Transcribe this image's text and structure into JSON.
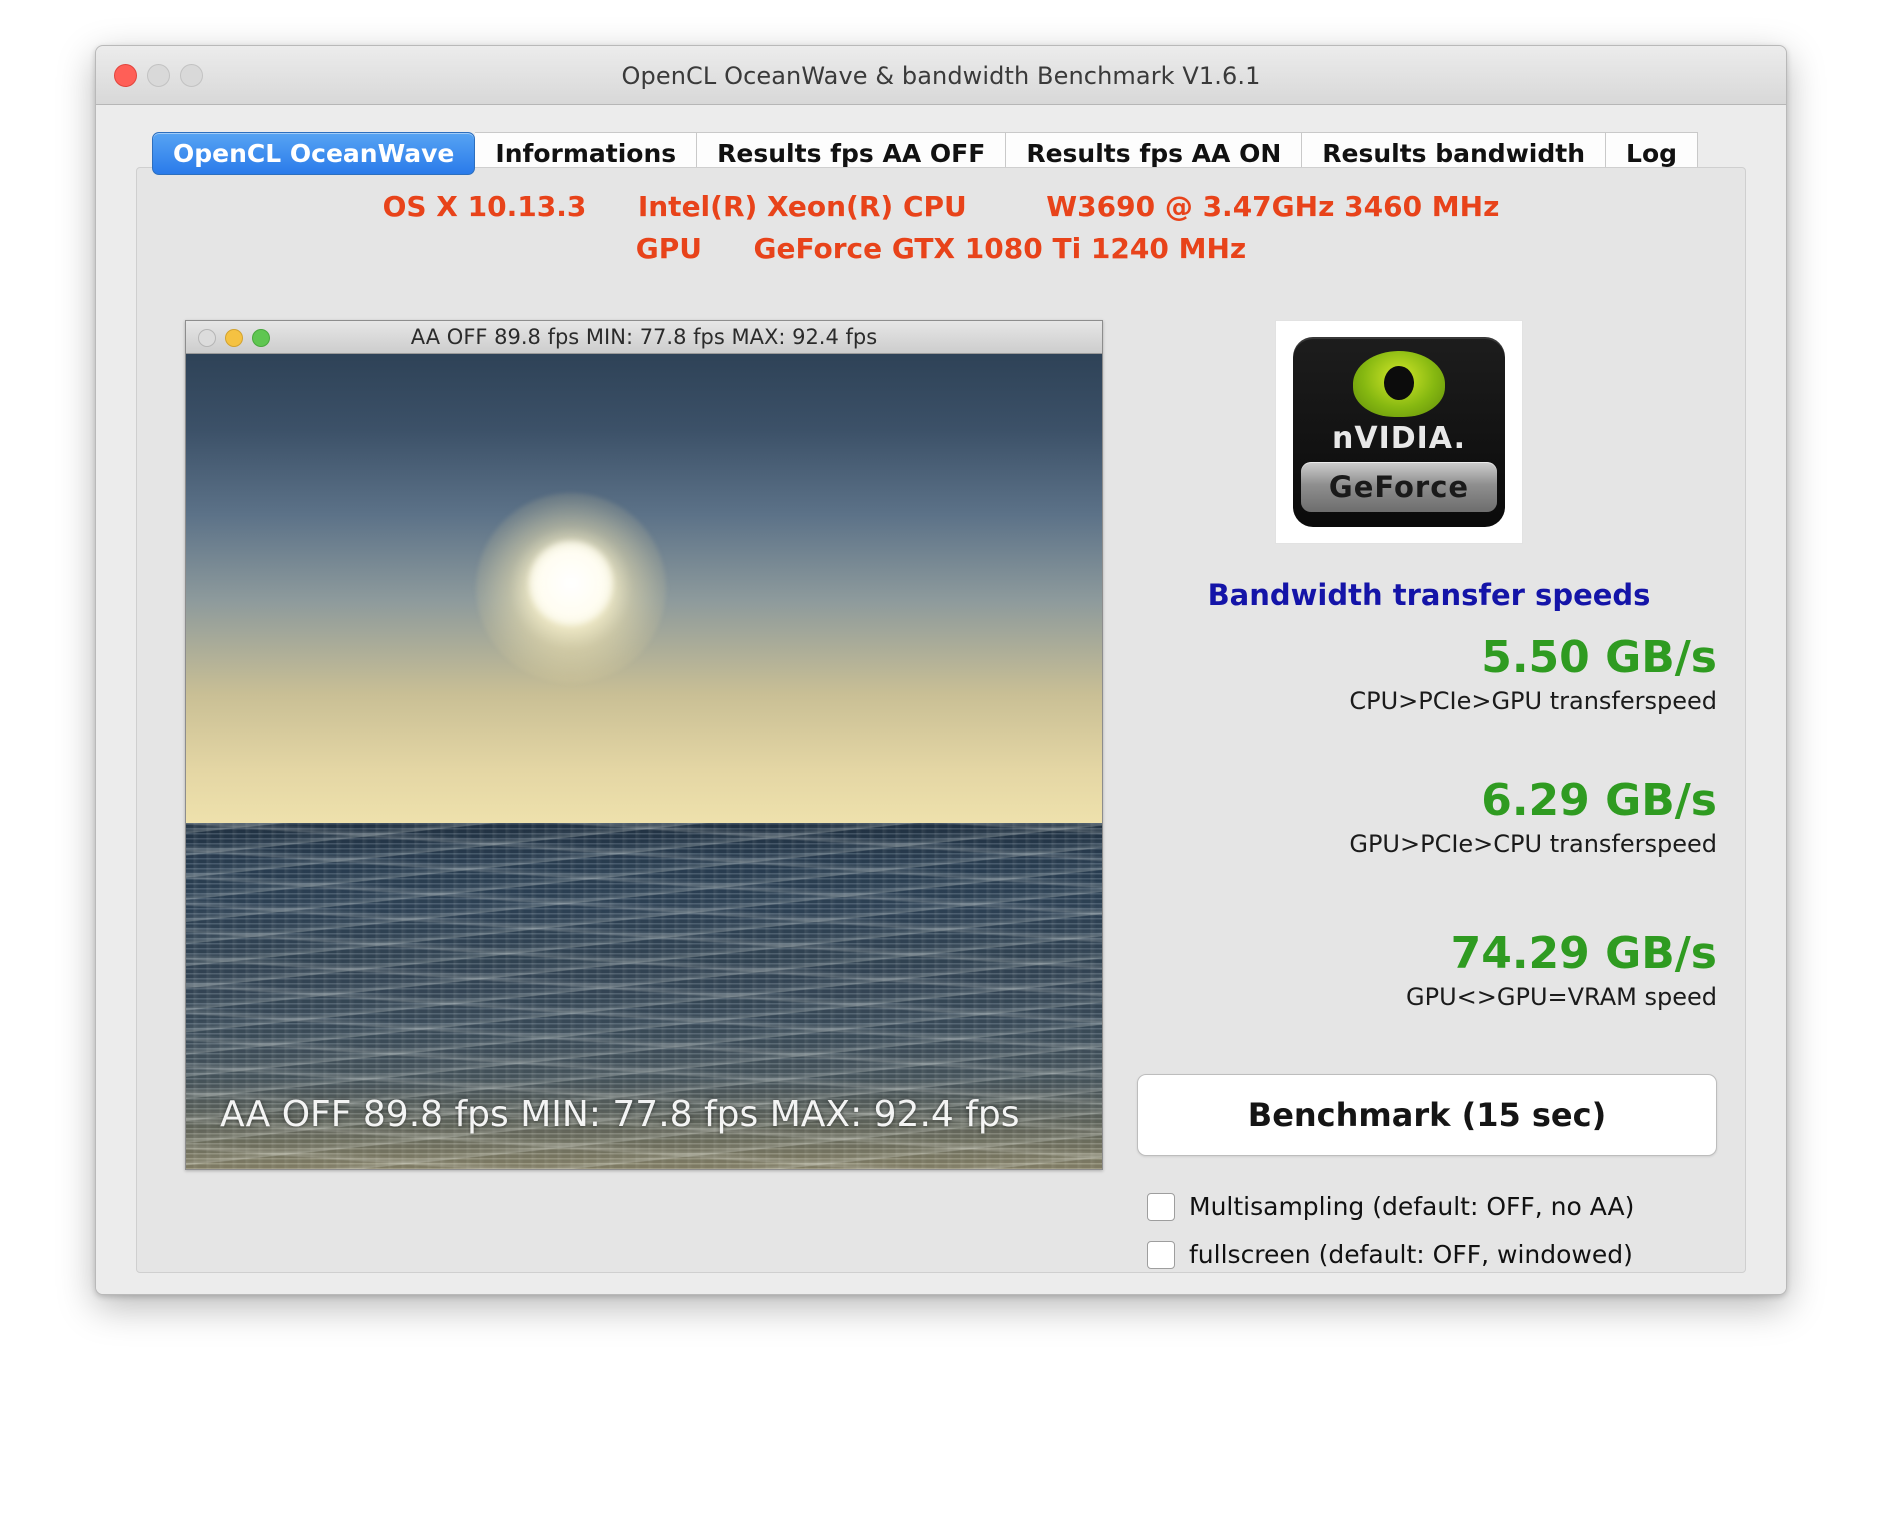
{
  "window": {
    "title": "OpenCL OceanWave & bandwidth Benchmark V1.6.1",
    "traffic": {
      "close": "close-button",
      "minimize": "minimize-button",
      "zoom": "zoom-button"
    }
  },
  "tabs": [
    {
      "label": "OpenCL OceanWave",
      "active": true
    },
    {
      "label": "Informations",
      "active": false
    },
    {
      "label": "Results fps AA OFF",
      "active": false
    },
    {
      "label": "Results fps AA ON",
      "active": false
    },
    {
      "label": "Results bandwidth",
      "active": false
    },
    {
      "label": "Log",
      "active": false
    }
  ],
  "sysinfo": {
    "os": "OS X 10.13.3",
    "cpu_vendor": "Intel(R) Xeon(R) CPU",
    "cpu_model": "W3690  @ 3.47GHz 3460 MHz",
    "gpu_label": "GPU",
    "gpu_model": "GeForce GTX 1080 Ti  1240 MHz",
    "color": "#e8431a"
  },
  "render": {
    "titlebar_text": "AA OFF   89.8 fps MIN: 77.8 fps MAX: 92.4 fps",
    "overlay_text": "AA OFF   89.8 fps MIN: 77.8 fps MAX: 92.4 fps",
    "aa_state": "AA OFF",
    "fps_current": "89.8 fps",
    "fps_min": "MIN: 77.8 fps",
    "fps_max": "MAX: 92.4 fps"
  },
  "logo": {
    "brand": "nVIDIA.",
    "sub_brand": "GeForce"
  },
  "bandwidth": {
    "title": "Bandwidth transfer speeds",
    "title_color": "#1414a8",
    "value_color": "#2f9b21",
    "items": [
      {
        "value": "5.50 GB/s",
        "label": "CPU>PCIe>GPU transferspeed"
      },
      {
        "value": "6.29 GB/s",
        "label": "GPU>PCIe>CPU transferspeed"
      },
      {
        "value": "74.29 GB/s",
        "label": "GPU<>GPU=VRAM speed"
      }
    ]
  },
  "controls": {
    "benchmark_button": "Benchmark  (15 sec)",
    "checkboxes": [
      {
        "label": "Multisampling (default: OFF, no AA)",
        "checked": false
      },
      {
        "label": "fullscreen (default: OFF, windowed)",
        "checked": false
      }
    ]
  }
}
